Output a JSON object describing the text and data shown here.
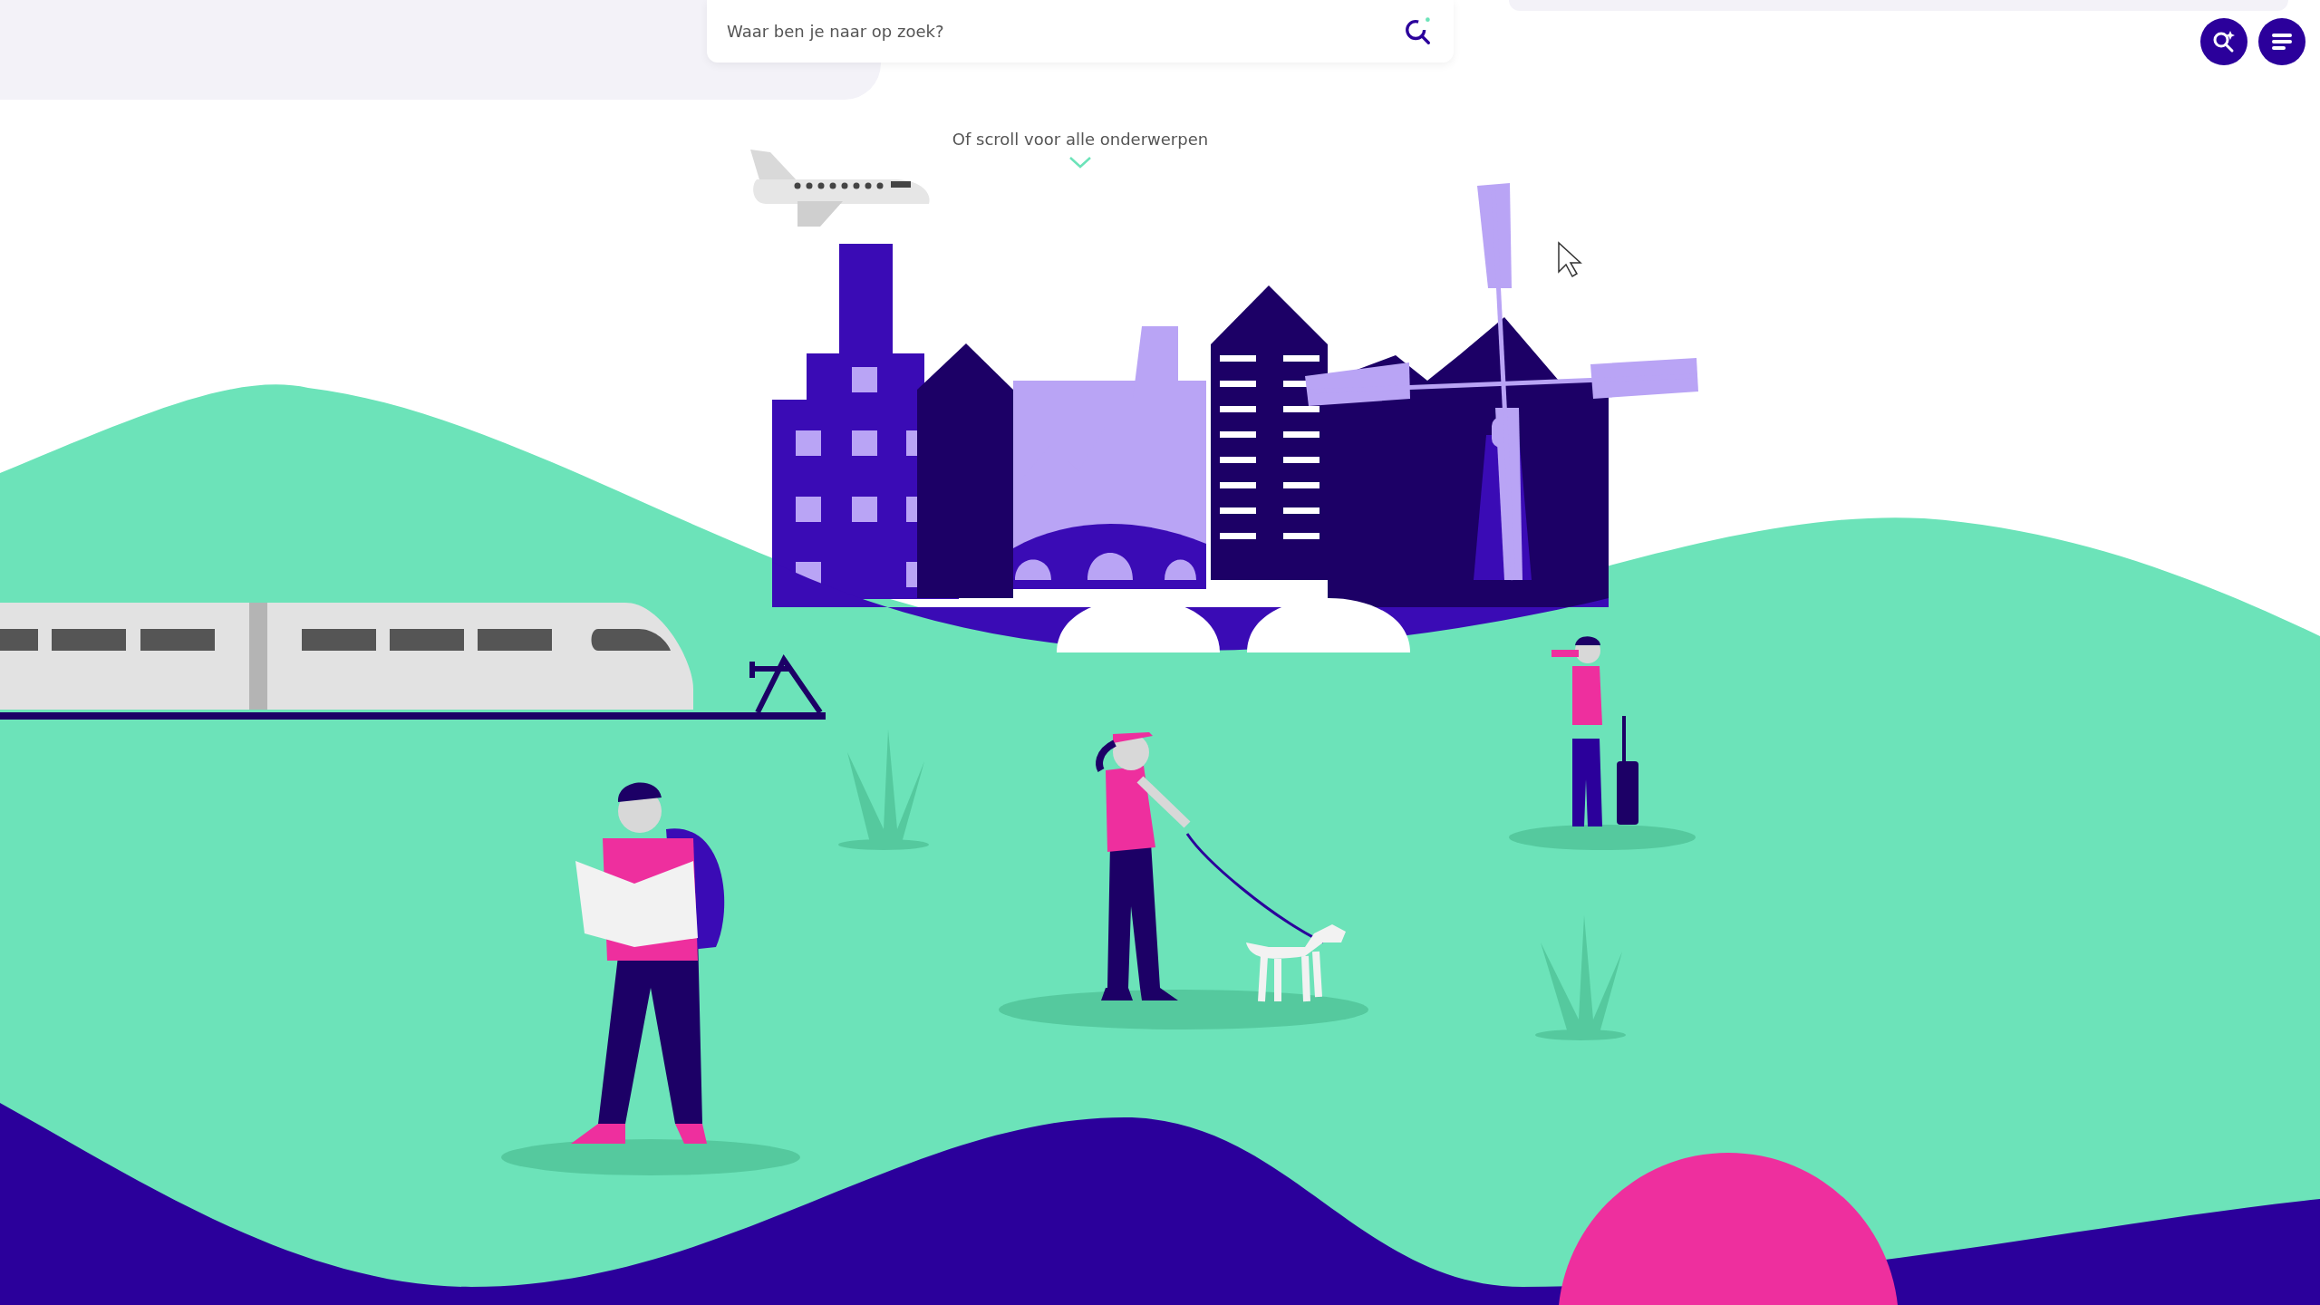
{
  "search": {
    "placeholder": "Waar ben je naar op zoek?"
  },
  "scroll_hint": {
    "text": "Of scroll voor alle onderwerpen"
  }
}
